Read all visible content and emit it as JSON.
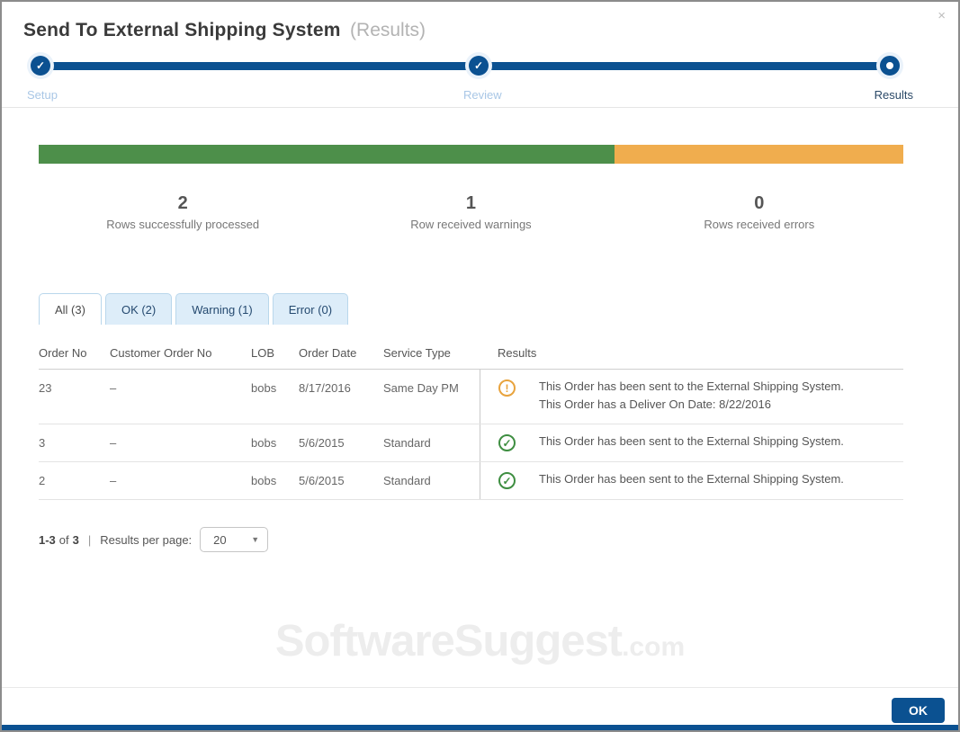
{
  "modal": {
    "title": "Send To External Shipping System",
    "subtitle": "(Results)",
    "close_icon": "×"
  },
  "stepper": {
    "steps": [
      {
        "label": "Setup",
        "state": "complete",
        "icon": "✓"
      },
      {
        "label": "Review",
        "state": "complete",
        "icon": "✓"
      },
      {
        "label": "Results",
        "state": "current",
        "icon": ""
      }
    ]
  },
  "progress": {
    "segments": [
      {
        "name": "success",
        "color": "#4d8f4a",
        "percent": 66.6
      },
      {
        "name": "warning",
        "color": "#f0ad4e",
        "percent": 33.4
      }
    ]
  },
  "stats": [
    {
      "value": "2",
      "label": "Rows successfully processed"
    },
    {
      "value": "1",
      "label": "Row received warnings"
    },
    {
      "value": "0",
      "label": "Rows received errors"
    }
  ],
  "tabs": [
    {
      "label": "All (3)",
      "active": true
    },
    {
      "label": "OK (2)",
      "active": false
    },
    {
      "label": "Warning (1)",
      "active": false
    },
    {
      "label": "Error (0)",
      "active": false
    }
  ],
  "table": {
    "columns": {
      "order_no": "Order No",
      "customer_order_no": "Customer Order No",
      "lob": "LOB",
      "order_date": "Order Date",
      "service_type": "Service Type",
      "results": "Results"
    },
    "rows": [
      {
        "order_no": "23",
        "customer_order_no": "–",
        "lob": "bobs",
        "order_date": "8/17/2016",
        "service_type": "Same Day PM",
        "status": "warning",
        "status_glyph": "!",
        "messages": [
          "This Order has been sent to the External Shipping System.",
          "This Order has a Deliver On Date: 8/22/2016"
        ]
      },
      {
        "order_no": "3",
        "customer_order_no": "–",
        "lob": "bobs",
        "order_date": "5/6/2015",
        "service_type": "Standard",
        "status": "ok",
        "status_glyph": "✓",
        "messages": [
          "This Order has been sent to the External Shipping System."
        ]
      },
      {
        "order_no": "2",
        "customer_order_no": "–",
        "lob": "bobs",
        "order_date": "5/6/2015",
        "service_type": "Standard",
        "status": "ok",
        "status_glyph": "✓",
        "messages": [
          "This Order has been sent to the External Shipping System."
        ]
      }
    ]
  },
  "pagination": {
    "range": "1-3",
    "of_label": "of",
    "total": "3",
    "separator": "|",
    "per_page_label": "Results per page:",
    "per_page_value": "20",
    "caret": "▼"
  },
  "watermark": {
    "main": "SoftwareSuggest",
    "suffix": ".com"
  },
  "footer": {
    "ok_label": "OK"
  },
  "colors": {
    "primary_blue": "#0b5191",
    "light_blue_label": "#a9c7e6",
    "success_green": "#4d8f4a",
    "warning_orange": "#f0ad4e",
    "tab_background": "#ddedf9",
    "tab_border": "#b9d7ec",
    "watermark_gray": "#ededed"
  }
}
